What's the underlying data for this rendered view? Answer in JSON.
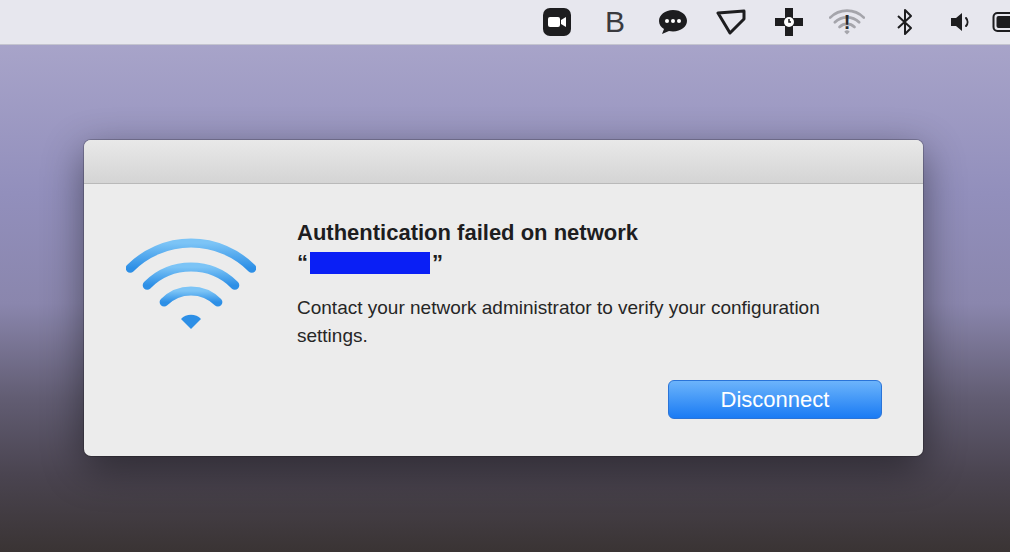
{
  "menu_bar": {
    "items": [
      {
        "kind": "zoom"
      },
      {
        "kind": "letter",
        "label": "B"
      },
      {
        "kind": "chat"
      },
      {
        "kind": "display"
      },
      {
        "kind": "tool"
      },
      {
        "kind": "wifi",
        "label": "!",
        "dimmed": true
      },
      {
        "kind": "bluetooth"
      },
      {
        "kind": "volume"
      },
      {
        "kind": "battery"
      }
    ]
  },
  "dialog": {
    "title": "Authentication failed on network",
    "network": {
      "open_quote": "“",
      "close_quote": "”",
      "redacted": true
    },
    "message": "Contact your network administrator to verify your configuration settings.",
    "buttons": [
      {
        "label": "Disconnect",
        "default": true
      }
    ]
  }
}
